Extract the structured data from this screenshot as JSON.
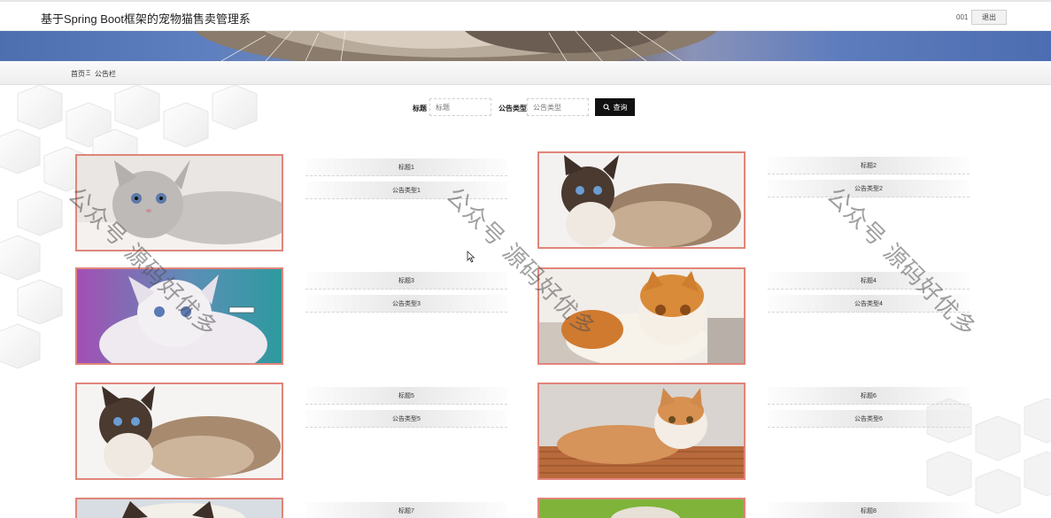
{
  "header": {
    "app_title": "基于Spring Boot框架的宠物猫售卖管理系",
    "user_name": "001",
    "logout_label": "退出"
  },
  "breadcrumb": {
    "home": "首页",
    "separator": "Ξ",
    "current": "公告栏"
  },
  "search": {
    "title_label": "标题",
    "title_placeholder": "标题",
    "type_label": "公告类型",
    "type_placeholder": "公告类型",
    "search_label": "查询",
    "search_icon": "search-icon"
  },
  "notices": [
    {
      "title": "标题1",
      "type": "公告类型1"
    },
    {
      "title": "标题2",
      "type": "公告类型2"
    },
    {
      "title": "标题3",
      "type": "公告类型3"
    },
    {
      "title": "标题4",
      "type": "公告类型4"
    },
    {
      "title": "标题5",
      "type": "公告类型5"
    },
    {
      "title": "标题6",
      "type": "公告类型6"
    },
    {
      "title": "标题7",
      "type": ""
    },
    {
      "title": "标题8",
      "type": ""
    }
  ],
  "watermark": {
    "text": "公众号 源码好优多"
  },
  "colors": {
    "card_border": "#e0857a",
    "button_bg": "#111111",
    "banner_blue": "#5e7fc0"
  }
}
